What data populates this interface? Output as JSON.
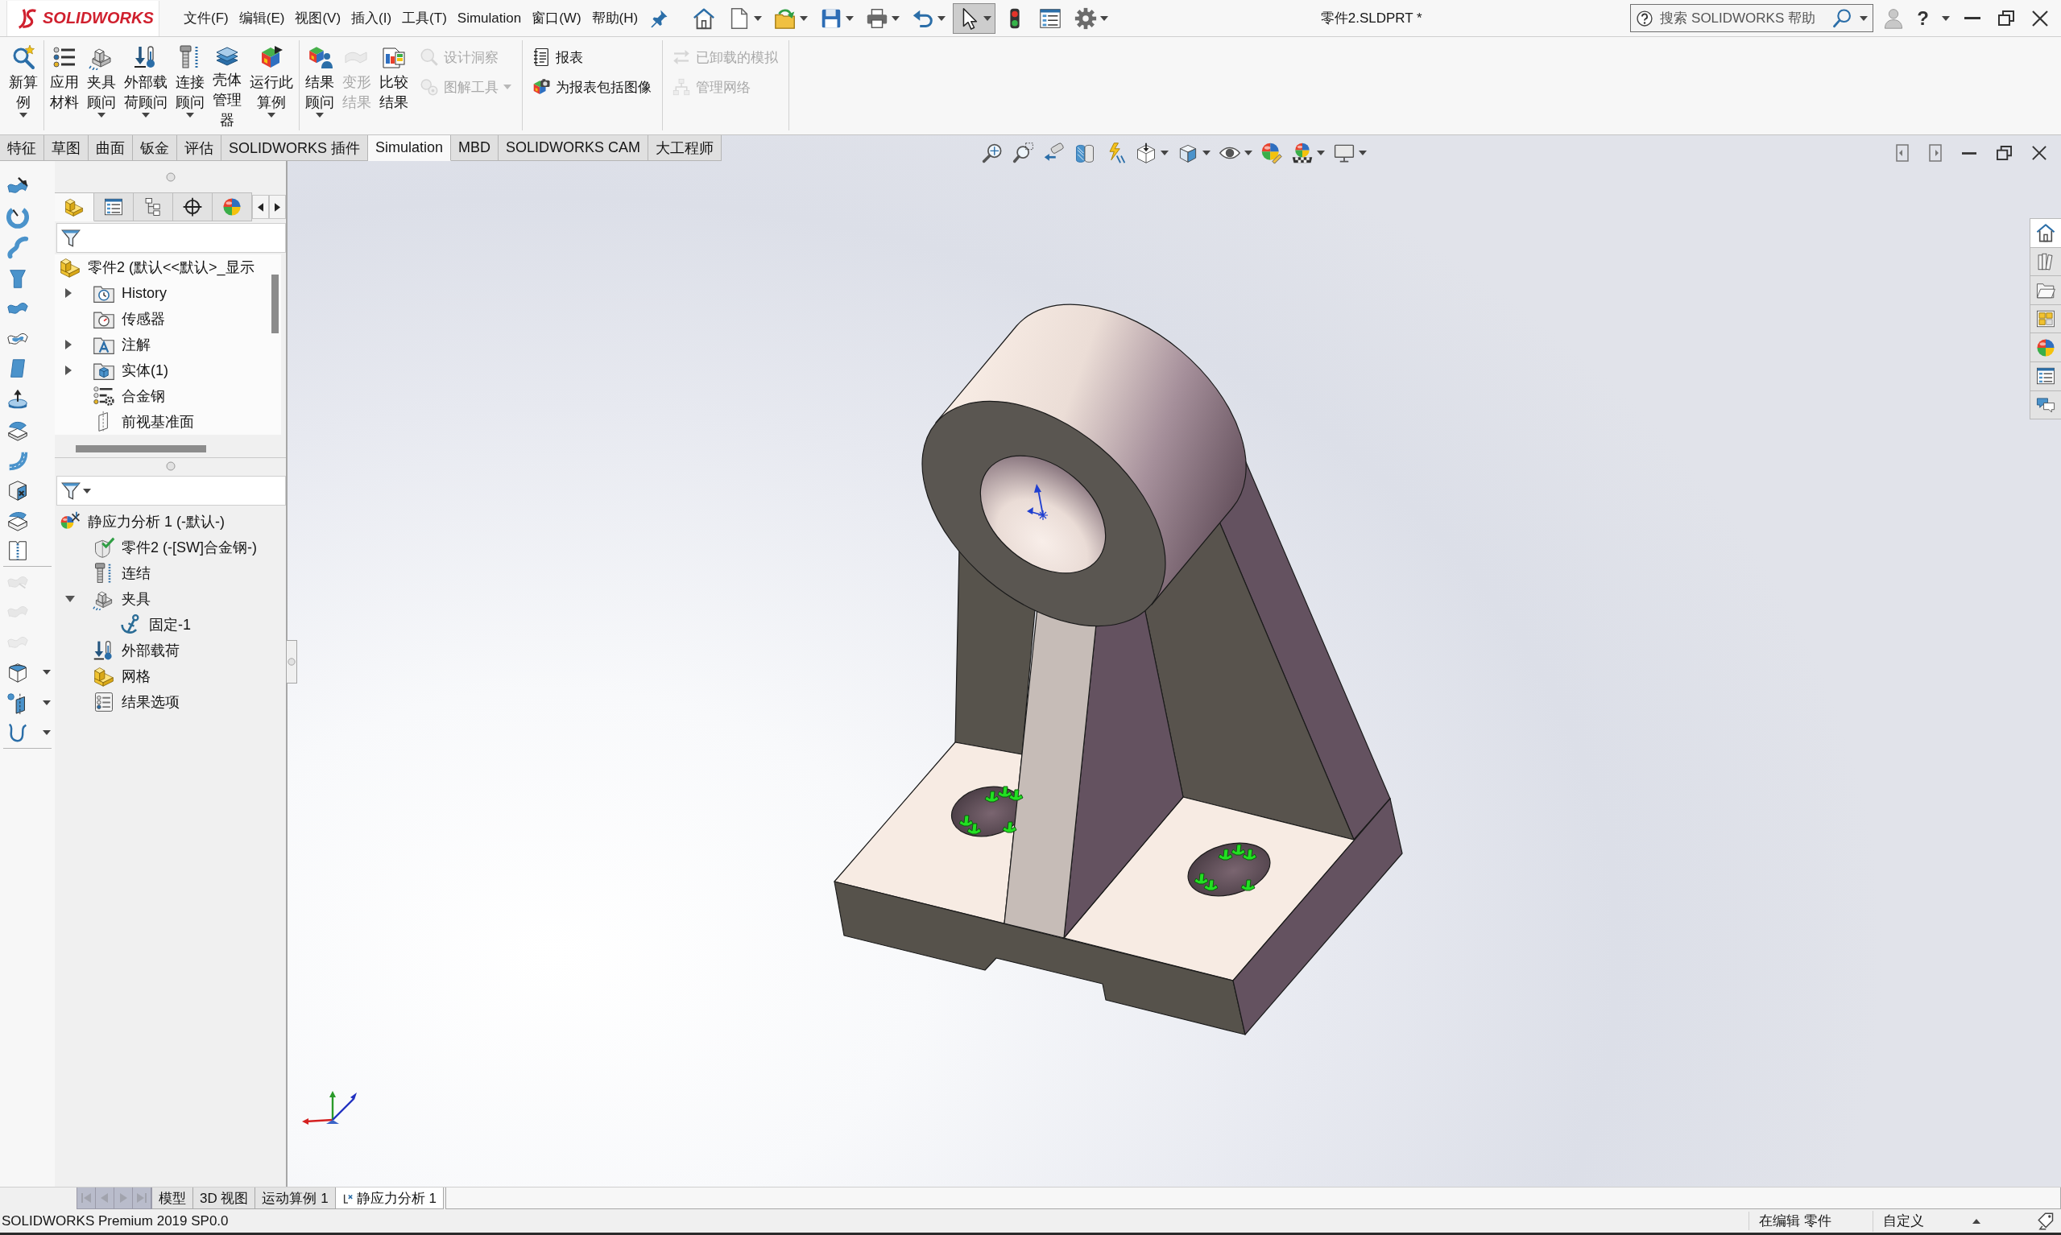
{
  "title_bar": {
    "logo": "SOLIDWORKS",
    "menu": [
      "文件(F)",
      "编辑(E)",
      "视图(V)",
      "插入(I)",
      "工具(T)",
      "Simulation",
      "窗口(W)",
      "帮助(H)"
    ],
    "quick_access": [
      {
        "kind": "home",
        "dropdown": false,
        "selected": false
      },
      {
        "kind": "new",
        "dropdown": true,
        "selected": false
      },
      {
        "kind": "open",
        "dropdown": true,
        "selected": false
      },
      {
        "kind": "save",
        "dropdown": true,
        "selected": false
      },
      {
        "kind": "print",
        "dropdown": true,
        "selected": false
      },
      {
        "kind": "undo",
        "dropdown": true,
        "selected": false
      },
      {
        "kind": "select",
        "dropdown": true,
        "selected": true
      },
      {
        "kind": "rebuild",
        "dropdown": false,
        "selected": false
      },
      {
        "kind": "file-properties",
        "dropdown": false,
        "selected": false
      },
      {
        "kind": "options",
        "dropdown": true,
        "selected": false
      }
    ],
    "document_title": "零件2.SLDPRT *",
    "search": {
      "placeholder": "搜索 SOLIDWORKS 帮助"
    },
    "help_label": "?"
  },
  "ribbon": {
    "groups": [
      {
        "large": [
          {
            "kind": "new-study",
            "lines": [
              "新算",
              "例"
            ],
            "dropdown": true,
            "disabled": false
          }
        ]
      },
      {
        "large": [
          {
            "kind": "apply-material",
            "lines": [
              "应用",
              "材料"
            ],
            "dropdown": false,
            "disabled": false
          },
          {
            "kind": "fixtures",
            "lines": [
              "夹具",
              "顾问"
            ],
            "dropdown": true,
            "disabled": false
          },
          {
            "kind": "loads",
            "lines": [
              "外部载",
              "荷顾问"
            ],
            "dropdown": true,
            "disabled": false
          },
          {
            "kind": "connections",
            "lines": [
              "连接",
              "顾问"
            ],
            "dropdown": true,
            "disabled": false
          },
          {
            "kind": "shell",
            "lines": [
              "壳体",
              "管理",
              "器"
            ],
            "dropdown": false,
            "disabled": false
          },
          {
            "kind": "run",
            "lines": [
              "运行此",
              "算例"
            ],
            "dropdown": true,
            "disabled": false
          }
        ]
      },
      {
        "large": [
          {
            "kind": "result-advisor",
            "lines": [
              "结果",
              "顾问"
            ],
            "dropdown": true,
            "disabled": false
          },
          {
            "kind": "deformed",
            "lines": [
              "变形",
              "结果"
            ],
            "dropdown": false,
            "disabled": true
          },
          {
            "kind": "compare",
            "lines": [
              "比较",
              "结果"
            ],
            "dropdown": false,
            "disabled": false
          }
        ],
        "small": [
          {
            "kind": "design-insight",
            "label": "设计洞察",
            "dropdown": false,
            "disabled": true
          },
          {
            "kind": "plot-tools",
            "label": "图解工具",
            "dropdown": true,
            "disabled": true
          }
        ]
      },
      {
        "small": [
          {
            "kind": "report",
            "label": "报表",
            "dropdown": false,
            "disabled": false
          },
          {
            "kind": "include-image",
            "label": "为报表包括图像",
            "dropdown": false,
            "disabled": false
          }
        ]
      },
      {
        "small": [
          {
            "kind": "unloaded",
            "label": "已卸载的模拟",
            "dropdown": false,
            "disabled": true
          },
          {
            "kind": "manage-network",
            "label": "管理网络",
            "dropdown": false,
            "disabled": true
          }
        ]
      }
    ]
  },
  "command_tabs": [
    {
      "label": "特征",
      "selected": false
    },
    {
      "label": "草图",
      "selected": false
    },
    {
      "label": "曲面",
      "selected": false
    },
    {
      "label": "钣金",
      "selected": false
    },
    {
      "label": "评估",
      "selected": false
    },
    {
      "label": "SOLIDWORKS 插件",
      "selected": false
    },
    {
      "label": "Simulation",
      "selected": true
    },
    {
      "label": "MBD",
      "selected": false
    },
    {
      "label": "SOLIDWORKS CAM",
      "selected": false
    },
    {
      "label": "大工程师",
      "selected": false
    }
  ],
  "side_toolbar": [
    [
      {
        "kind": "extruded-surface",
        "disabled": false,
        "dropdown": false
      },
      {
        "kind": "revolved-surface",
        "disabled": false,
        "dropdown": false
      },
      {
        "kind": "swept-surface",
        "disabled": false,
        "dropdown": false
      },
      {
        "kind": "lofted-surface",
        "disabled": false,
        "dropdown": false
      },
      {
        "kind": "boundary-surface",
        "disabled": false,
        "dropdown": false
      },
      {
        "kind": "filled-surface",
        "disabled": false,
        "dropdown": false
      },
      {
        "kind": "planar-surface",
        "disabled": false,
        "dropdown": false
      },
      {
        "kind": "extrude-disc",
        "disabled": false,
        "dropdown": false
      },
      {
        "kind": "offset-surface",
        "disabled": false,
        "dropdown": false
      },
      {
        "kind": "ruled-surface",
        "disabled": false,
        "dropdown": false
      },
      {
        "kind": "delete-face",
        "disabled": false,
        "dropdown": false
      },
      {
        "kind": "replace-face",
        "disabled": false,
        "dropdown": false
      },
      {
        "kind": "knit-surface",
        "disabled": false,
        "dropdown": false
      }
    ],
    [
      {
        "kind": "untrim-surface",
        "disabled": true,
        "dropdown": false
      },
      {
        "kind": "extend-surface",
        "disabled": true,
        "dropdown": false
      },
      {
        "kind": "trim-surface",
        "disabled": true,
        "dropdown": false
      },
      {
        "kind": "thicken",
        "disabled": false,
        "dropdown": true
      },
      {
        "kind": "reference-geometry",
        "disabled": false,
        "dropdown": true
      },
      {
        "kind": "curves",
        "disabled": false,
        "dropdown": true
      }
    ]
  ],
  "feature_manager": {
    "tabs": [
      {
        "kind": "feature-tree",
        "selected": true
      },
      {
        "kind": "property-manager",
        "selected": false
      },
      {
        "kind": "configuration-manager",
        "selected": false
      },
      {
        "kind": "dimxpert",
        "selected": false
      },
      {
        "kind": "display-manager",
        "selected": false
      }
    ],
    "tree": [
      {
        "label": "零件2 (默认<<默认>_显示",
        "kind": "part",
        "children": [
          {
            "label": "History",
            "kind": "history",
            "expanded": false
          },
          {
            "label": "传感器",
            "kind": "sensors"
          },
          {
            "label": "注解",
            "kind": "annotations",
            "expanded": false
          },
          {
            "label": "实体(1)",
            "kind": "solid-bodies",
            "expanded": false
          },
          {
            "label": "合金钢",
            "kind": "material"
          },
          {
            "label": "前视基准面",
            "kind": "plane"
          }
        ]
      }
    ],
    "study_tree": [
      {
        "label": "静应力分析 1 (-默认-)",
        "kind": "study",
        "children": [
          {
            "label": "零件2 (-[SW]合金钢-)",
            "kind": "part-check"
          },
          {
            "label": "连结",
            "kind": "connections"
          },
          {
            "label": "夹具",
            "kind": "fixtures",
            "expanded": true,
            "children": [
              {
                "label": "固定-1",
                "kind": "fixed"
              }
            ]
          },
          {
            "label": "外部载荷",
            "kind": "loads"
          },
          {
            "label": "网格",
            "kind": "mesh"
          },
          {
            "label": "结果选项",
            "kind": "result-options"
          }
        ]
      }
    ]
  },
  "viewport": {
    "view_toolbar": [
      {
        "kind": "zoom-fit",
        "dropdown": false
      },
      {
        "kind": "zoom-area",
        "dropdown": false
      },
      {
        "kind": "previous-view",
        "dropdown": false
      },
      {
        "kind": "section-view",
        "dropdown": false
      },
      {
        "kind": "dynamic-annotation",
        "dropdown": false
      },
      {
        "kind": "view-orientation",
        "dropdown": true
      },
      {
        "kind": "display-style",
        "dropdown": true
      },
      {
        "kind": "hide-show",
        "dropdown": true
      },
      {
        "kind": "edit-appearance",
        "dropdown": false
      },
      {
        "kind": "apply-scene",
        "dropdown": true
      },
      {
        "kind": "view-settings",
        "dropdown": true
      }
    ],
    "task_pane": [
      {
        "kind": "home",
        "selected": true
      },
      {
        "kind": "design-library",
        "selected": false
      },
      {
        "kind": "file-explorer",
        "selected": false
      },
      {
        "kind": "view-palette",
        "selected": false
      },
      {
        "kind": "appearances",
        "selected": false
      },
      {
        "kind": "custom-properties",
        "selected": false
      },
      {
        "kind": "forum",
        "selected": false
      }
    ]
  },
  "tab_nav": [
    {
      "kind": "first",
      "disabled": true
    },
    {
      "kind": "previous",
      "disabled": true
    },
    {
      "kind": "next",
      "disabled": true
    },
    {
      "kind": "last",
      "disabled": true
    }
  ],
  "bottom_tabs": [
    {
      "label": "模型",
      "kind": "model",
      "selected": false
    },
    {
      "label": "3D 视图",
      "kind": "view",
      "selected": false
    },
    {
      "label": "运动算例 1",
      "kind": "motion",
      "selected": false
    },
    {
      "label": "静应力分析 1",
      "kind": "simulation",
      "selected": true
    }
  ],
  "status_bar": {
    "product": "SOLIDWORKS Premium 2019 SP0.0",
    "mode": "在编辑 零件",
    "units": "自定义"
  }
}
